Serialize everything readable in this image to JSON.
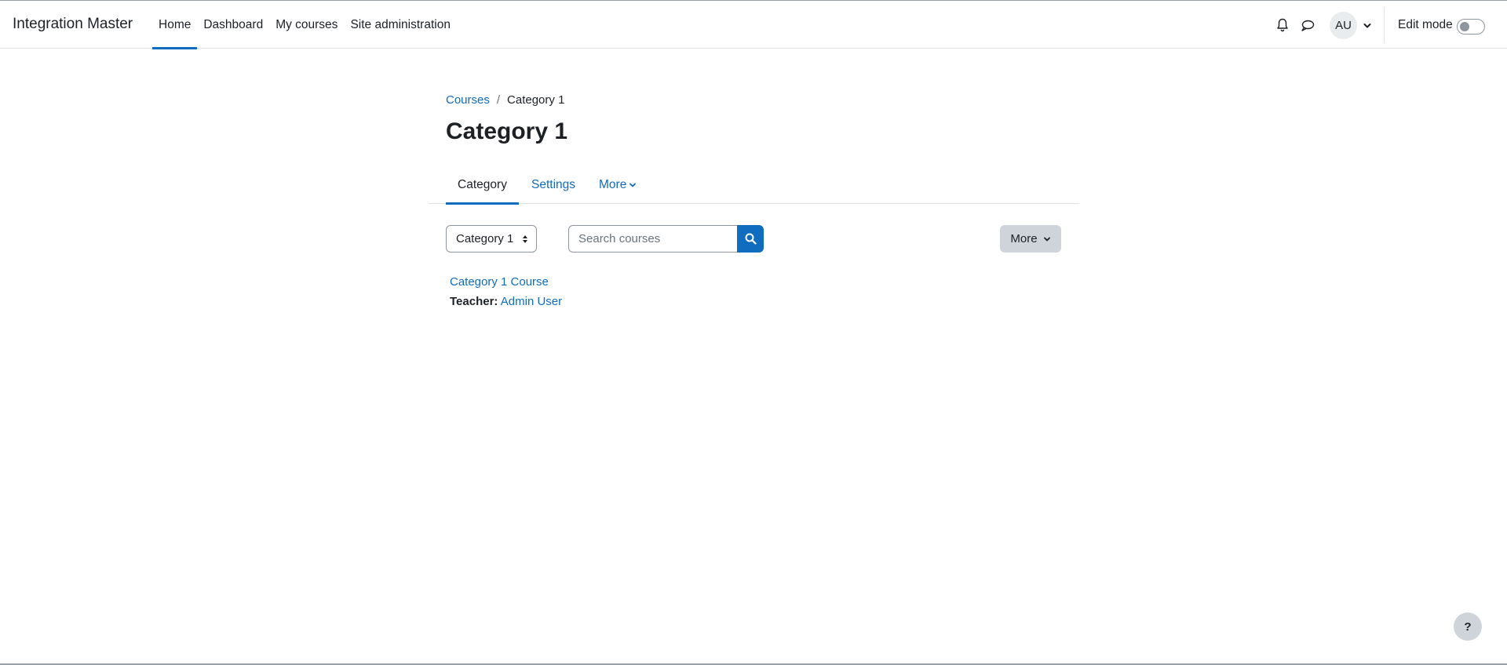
{
  "navbar": {
    "site_name": "Integration Master",
    "primary_nav": [
      {
        "label": "Home",
        "active": true
      },
      {
        "label": "Dashboard",
        "active": false
      },
      {
        "label": "My courses",
        "active": false
      },
      {
        "label": "Site administration",
        "active": false
      }
    ],
    "icons": {
      "notifications": "bell-icon",
      "messages": "chat-bubble-icon"
    },
    "user_initials": "AU",
    "edit_mode_label": "Edit mode",
    "edit_mode_on": false
  },
  "breadcrumb": {
    "parent": "Courses",
    "separator": "/",
    "current": "Category 1"
  },
  "page_title": "Category 1",
  "secondary_nav": {
    "tabs": [
      {
        "label": "Category",
        "active": true
      },
      {
        "label": "Settings",
        "active": false
      },
      {
        "label": "More",
        "active": false
      }
    ]
  },
  "toolbar": {
    "category_select_value": "Category 1",
    "search_placeholder": "Search courses",
    "more_label": "More"
  },
  "courses": [
    {
      "name": "Category 1 Course",
      "teacher_label": "Teacher:",
      "teacher_name": "Admin User"
    }
  ],
  "help_label": "?",
  "colors": {
    "accent": "#0f6cbf",
    "text": "#1d2125",
    "secondary_button": "#ced4da"
  }
}
